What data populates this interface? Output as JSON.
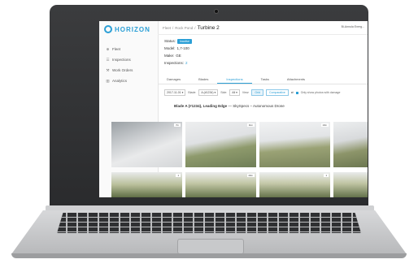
{
  "app": {
    "logo_text": "HORIZON",
    "brand_color": "#2b9fd6"
  },
  "sidebar": {
    "items": [
      {
        "icon": "fleet-icon",
        "label": "Fleet"
      },
      {
        "icon": "inspections-icon",
        "label": "Inspections"
      },
      {
        "icon": "wrench-icon",
        "label": "Work Orders"
      },
      {
        "icon": "analytics-icon",
        "label": "Analytics"
      }
    ]
  },
  "breadcrumb": {
    "items": [
      "Fleet",
      "Rock Pond"
    ],
    "current": "Turbine 2"
  },
  "user": {
    "name": "Bi-Annula Energ..."
  },
  "details": {
    "status_label": "Status:",
    "status_value": "Inactive",
    "model_label": "Model:",
    "model_value": "1,7-100",
    "make_label": "Make:",
    "make_value": "GE",
    "inspections_label": "Inspections:",
    "inspections_value": "2"
  },
  "tabs": [
    {
      "label": "Damages",
      "active": false
    },
    {
      "label": "Blades",
      "active": false
    },
    {
      "label": "Inspections",
      "active": true
    },
    {
      "label": "Tasks",
      "active": false
    },
    {
      "label": "Attachments",
      "active": false
    }
  ],
  "filters": {
    "date": "2017-11-01",
    "blade_label": "Blade:",
    "blade_value": "A (#1234)",
    "side_label": "Side:",
    "side_value": "All",
    "view_label": "View:",
    "view_grid": "Grid",
    "view_comparative": "Comparative",
    "only_damage_label": "Only show photos with damage"
  },
  "group": {
    "title": "Blade A (#1234), Leading Edge",
    "subtitle": " — SkySpecs – Autonomous Drone"
  },
  "photos": [
    {
      "badge": "7m"
    },
    {
      "badge": "11m"
    },
    {
      "badge": "13m"
    },
    {
      "badge": ""
    },
    {
      "badge": "1"
    },
    {
      "badge": "20m"
    },
    {
      "badge": "1"
    },
    {
      "badge": ""
    }
  ]
}
